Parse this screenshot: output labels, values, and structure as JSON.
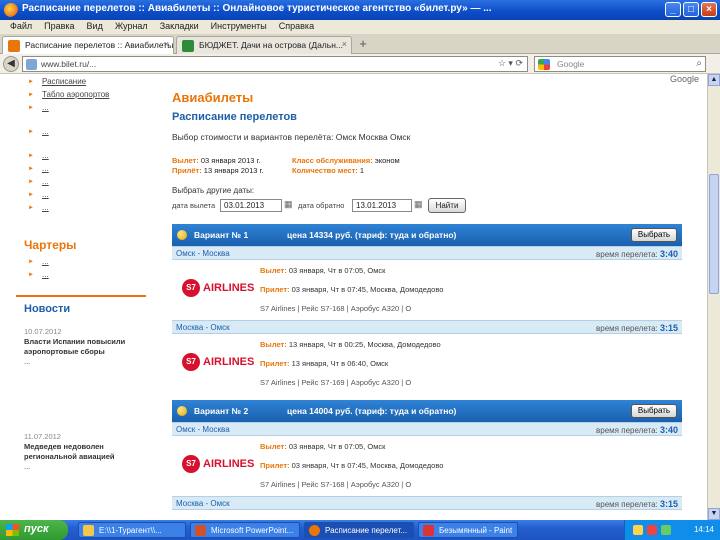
{
  "window": {
    "title": "Расписание перелетов :: Авиабилеты :: Онлайновое туристическое агентство «билет.ру» — ..."
  },
  "menu": [
    "Файл",
    "Правка",
    "Вид",
    "Журнал",
    "Закладки",
    "Инструменты",
    "Справка"
  ],
  "tabs": [
    {
      "label": "Расписание перелетов :: Авиабилеты :: ...",
      "active": true
    },
    {
      "label": "БЮДЖЕТ. Дачи на острова (Дальн...",
      "active": false
    }
  ],
  "nav": {
    "url": "www.bilet.ru/...",
    "search_placeholder": "Google"
  },
  "sidebar": {
    "links": [
      "Расписание",
      "Табло аэропортов",
      "...",
      "...",
      "...",
      "...",
      "...",
      "...",
      "..."
    ],
    "charters_title": "Чартеры",
    "charter_links": [
      "...",
      "..."
    ],
    "news_title": "Новости",
    "news": [
      {
        "date": "10.07.2012",
        "lines": [
          "Власти Испании повысили",
          "аэропортовые сборы",
          "..."
        ]
      },
      {
        "date": "11.07.2012",
        "lines": [
          "Медведев недоволен",
          "региональной авиацией",
          "..."
        ]
      }
    ]
  },
  "page": {
    "brand_suffix": "Google",
    "h1": "Авиабилеты",
    "h2": "Расписание перелетов",
    "crumb": "Выбор стоимости и вариантов перелёта: Омск  Москва  Омск",
    "info": {
      "depart_label": "Вылет:",
      "depart_value": "03 января 2013 г.",
      "arrive_label": "Прилёт:",
      "arrive_value": "13 января 2013 г.",
      "class_label": "Класс обслуживания:",
      "class_value": "эконом",
      "pax_label": "Количество мест:",
      "pax_value": "1"
    },
    "other_dates_label": "Выбрать другие даты:",
    "date_there_label": "дата вылета",
    "date_there": "03.01.2013",
    "date_back_label": "дата обратно",
    "date_back": "13.01.2013",
    "find_button": "Найти"
  },
  "variants": [
    {
      "num": "Вариант № 1",
      "price": "цена 14334 руб. (тариф: туда и обратно)",
      "choose": "Выбрать",
      "segments": [
        {
          "route": "Омск - Москва",
          "time_label": "время перелета:",
          "time": "3:40",
          "airline": "AIRLINES",
          "dep": {
            "label": "Вылет:",
            "text": "03 января, Чт в 07:05, Омск"
          },
          "arr": {
            "label": "Прилет:",
            "text": "03 января, Чт в 07:45, Москва, Домодедово"
          },
          "flight": "S7 Airlines | Рейс S7-168 | Аэробус A320 | O"
        },
        {
          "route": "Москва - Омск",
          "time_label": "время перелета:",
          "time": "3:15",
          "airline": "AIRLINES",
          "dep": {
            "label": "Вылет:",
            "text": "13 января, Чт в 00:25, Москва, Домодедово"
          },
          "arr": {
            "label": "Прилет:",
            "text": "13 января, Чт в 06:40, Омск"
          },
          "flight": "S7 Airlines | Рейс S7-169 | Аэробус A320 | O"
        }
      ]
    },
    {
      "num": "Вариант № 2",
      "price": "цена 14004 руб. (тариф: туда и обратно)",
      "choose": "Выбрать",
      "segments": [
        {
          "route": "Омск - Москва",
          "time_label": "время перелета:",
          "time": "3:40",
          "airline": "AIRLINES",
          "dep": {
            "label": "Вылет:",
            "text": "03 января, Чт в 07:05, Омск"
          },
          "arr": {
            "label": "Прилет:",
            "text": "03 января, Чт в 07:45, Москва, Домодедово"
          },
          "flight": "S7 Airlines | Рейс S7-168 | Аэробус A320 | O"
        },
        {
          "route": "Москва - Омск",
          "time_label": "время перелета:",
          "time": "3:15"
        }
      ]
    }
  ],
  "taskbar": {
    "start": "пуск",
    "items": [
      "E:\\\\1-Турагент\\\\...",
      "Microsoft PowerPoint...",
      "Расписание перелет...",
      "Безымянный - Paint"
    ],
    "clock": "14:14"
  },
  "colors": {
    "accent": "#e8760a",
    "blue": "#1e5fa8",
    "s7": "#d7102d"
  }
}
